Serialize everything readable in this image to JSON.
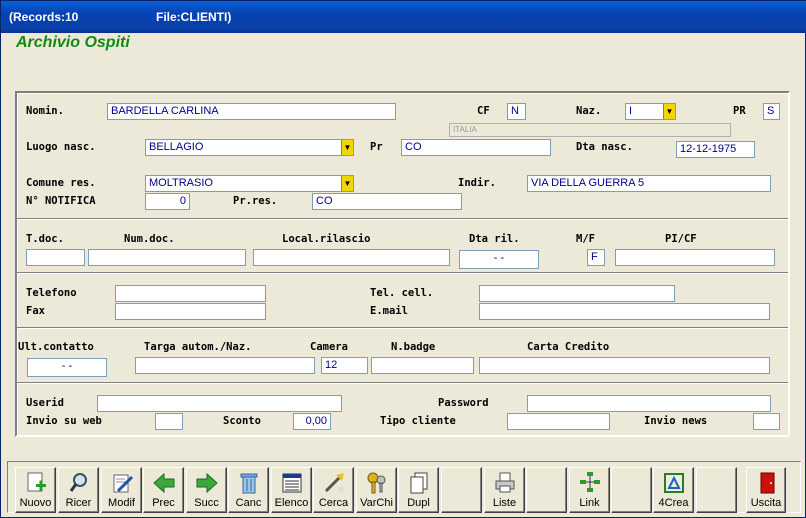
{
  "titlebar": {
    "records": "(Records:10",
    "file": "File:CLIENTI)"
  },
  "app_title": "Archivio Ospiti",
  "labels": {
    "nomin": "Nomin.",
    "cf": "CF",
    "naz": "Naz.",
    "pr": "PR",
    "luogo": "Luogo nasc.",
    "pr2": "Pr",
    "dta": "Dta nasc.",
    "comune": "Comune res.",
    "indir": "Indir.",
    "notifica": "N° NOTIFICA",
    "prres": "Pr.res.",
    "tdoc": "T.doc.",
    "numdoc": "Num.doc.",
    "local": "Local.rilascio",
    "dtaril": "Dta ril.",
    "mf": "M/F",
    "picf": "PI/CF",
    "tel": "Telefono",
    "telcell": "Tel. cell.",
    "fax": "Fax",
    "email": "E.mail",
    "ultc": "Ult.contatto",
    "targa": "Targa autom./Naz.",
    "camera": "Camera",
    "nbadge": "N.badge",
    "carta": "Carta Credito",
    "userid": "Userid",
    "password": "Password",
    "invioweb": "Invio su web",
    "sconto": "Sconto",
    "tipocli": "Tipo cliente",
    "invionews": "Invio news"
  },
  "values": {
    "nomin": "BARDELLA CARLINA",
    "cf": "N",
    "naz": "I",
    "pr": "S",
    "italia": "ITALIA",
    "luogo": "BELLAGIO",
    "pr2": "CO",
    "dta": "12-12-1975",
    "comune": "MOLTRASIO",
    "indir": "VIA DELLA GUERRA 5",
    "notifica": "0",
    "prres": "CO",
    "dtaril": "  -  -",
    "mf": "F",
    "ultc": "  -  -",
    "camera": "12",
    "sconto": "0,00"
  },
  "toolbar": [
    "Nuovo",
    "Ricer",
    "Modif",
    "Prec",
    "Succ",
    "Canc",
    "Elenco",
    "Cerca",
    "VarChi",
    "Dupl",
    "",
    "Liste",
    "",
    "Link",
    "",
    "4Crea",
    "",
    "Uscita"
  ],
  "icons": [
    "new-doc-icon",
    "search-icon",
    "edit-icon",
    "prev-arrow-icon",
    "next-arrow-icon",
    "trash-icon",
    "list-icon",
    "find-icon",
    "keys-icon",
    "duplicate-icon",
    "",
    "printer-icon",
    "",
    "link-icon",
    "",
    "create-icon",
    "",
    "exit-door-icon"
  ]
}
